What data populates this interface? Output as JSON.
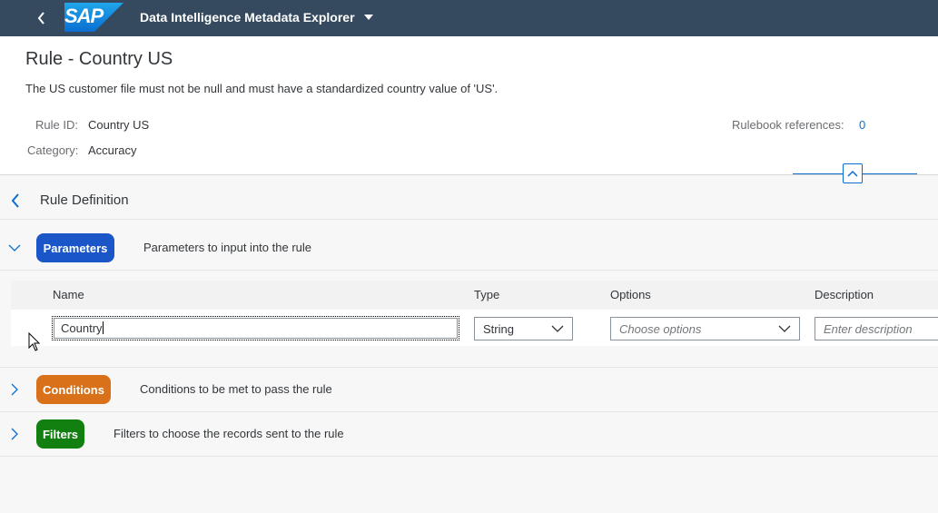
{
  "shell": {
    "app_title": "Data Intelligence Metadata Explorer",
    "logo_text": "SAP"
  },
  "header": {
    "title": "Rule - Country US",
    "description": "The US customer file must not be null and must have a standardized country value of 'US'.",
    "rule_id_label": "Rule ID:",
    "rule_id_value": "Country US",
    "category_label": "Category:",
    "category_value": "Accuracy",
    "rulebook_label": "Rulebook references:",
    "rulebook_value": "0"
  },
  "section": {
    "title": "Rule Definition"
  },
  "parameters": {
    "pill_label": "Parameters",
    "description": "Parameters to input into the rule",
    "color": "#1a56c8",
    "table": {
      "columns": [
        "Name",
        "Type",
        "Options",
        "Description"
      ],
      "row": {
        "name_value": "Country",
        "type_value": "String",
        "options_placeholder": "Choose options",
        "description_placeholder": "Enter description"
      }
    }
  },
  "conditions": {
    "pill_label": "Conditions",
    "description": "Conditions to be met to pass the rule",
    "color": "#d9711b"
  },
  "filters": {
    "pill_label": "Filters",
    "description": "Filters to choose the records sent to the rule",
    "color": "#128011"
  },
  "colors": {
    "shell": "#354a5f",
    "link": "#0a6ed1"
  }
}
